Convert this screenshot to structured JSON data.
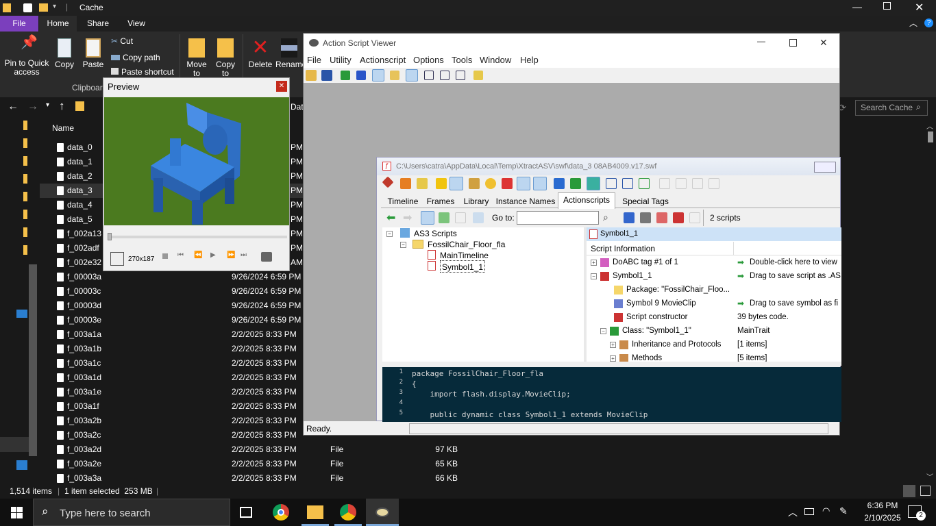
{
  "explorer": {
    "window_title": "Cache",
    "tabs": [
      "File",
      "Home",
      "Share",
      "View"
    ],
    "ribbon": {
      "pin_label": "Pin to Quick access",
      "copy_label": "Copy",
      "paste_label": "Paste",
      "cut_label": "Cut",
      "copy_path_label": "Copy path",
      "paste_shortcut_label": "Paste shortcut",
      "clipboard_group": "Clipboard",
      "move_to_label": "Move to",
      "copy_to_label": "Copy to",
      "delete_label": "Delete",
      "rename_label": "Rename"
    },
    "search_placeholder": "Search Cache",
    "column_name": "Name",
    "column_date_partial": "Dat",
    "files": [
      {
        "name": "data_0",
        "date": "",
        "type": "",
        "size": "",
        "partial": "PM"
      },
      {
        "name": "data_1",
        "date": "",
        "type": "",
        "size": "",
        "partial": "PM"
      },
      {
        "name": "data_2",
        "date": "",
        "type": "",
        "size": "",
        "partial": "PM"
      },
      {
        "name": "data_3",
        "date": "",
        "type": "",
        "size": "",
        "partial": "PM"
      },
      {
        "name": "data_4",
        "date": "",
        "type": "",
        "size": "",
        "partial": "PM"
      },
      {
        "name": "data_5",
        "date": "",
        "type": "",
        "size": "",
        "partial": "PM"
      },
      {
        "name": "f_002a13",
        "date": "",
        "type": "",
        "size": "",
        "partial": "PM"
      },
      {
        "name": "f_002adf",
        "date": "",
        "type": "",
        "size": "",
        "partial": "PM"
      },
      {
        "name": "f_002e32",
        "date": "",
        "type": "",
        "size": "",
        "partial": "AM"
      },
      {
        "name": "f_00003a",
        "date": "9/26/2024 6:59 PM",
        "type": "",
        "size": "",
        "partial": ""
      },
      {
        "name": "f_00003c",
        "date": "9/26/2024 6:59 PM",
        "type": "",
        "size": "",
        "partial": ""
      },
      {
        "name": "f_00003d",
        "date": "9/26/2024 6:59 PM",
        "type": "",
        "size": "",
        "partial": ""
      },
      {
        "name": "f_00003e",
        "date": "9/26/2024 6:59 PM",
        "type": "",
        "size": "",
        "partial": ""
      },
      {
        "name": "f_003a1a",
        "date": "2/2/2025 8:33 PM",
        "type": "",
        "size": "",
        "partial": ""
      },
      {
        "name": "f_003a1b",
        "date": "2/2/2025 8:33 PM",
        "type": "",
        "size": "",
        "partial": ""
      },
      {
        "name": "f_003a1c",
        "date": "2/2/2025 8:33 PM",
        "type": "",
        "size": "",
        "partial": ""
      },
      {
        "name": "f_003a1d",
        "date": "2/2/2025 8:33 PM",
        "type": "",
        "size": "",
        "partial": ""
      },
      {
        "name": "f_003a1e",
        "date": "2/2/2025 8:33 PM",
        "type": "",
        "size": "",
        "partial": ""
      },
      {
        "name": "f_003a1f",
        "date": "2/2/2025 8:33 PM",
        "type": "",
        "size": "",
        "partial": ""
      },
      {
        "name": "f_003a2b",
        "date": "2/2/2025 8:33 PM",
        "type": "",
        "size": "",
        "partial": ""
      },
      {
        "name": "f_003a2c",
        "date": "2/2/2025 8:33 PM",
        "type": "",
        "size": "",
        "partial": ""
      },
      {
        "name": "f_003a2d",
        "date": "2/2/2025 8:33 PM",
        "type": "File",
        "size": "97 KB",
        "partial": ""
      },
      {
        "name": "f_003a2e",
        "date": "2/2/2025 8:33 PM",
        "type": "File",
        "size": "65 KB",
        "partial": ""
      },
      {
        "name": "f_003a3a",
        "date": "2/2/2025 8:33 PM",
        "type": "File",
        "size": "66 KB",
        "partial": ""
      }
    ],
    "status_items": "1,514 items",
    "status_selected": "1 item selected  253 MB"
  },
  "preview": {
    "title": "Preview",
    "size_label": "270x187",
    "scene_colors": {
      "background": "#4b7a1f",
      "chair": "#3a7fd6"
    }
  },
  "asv": {
    "title": "Action Script Viewer",
    "menu": [
      "File",
      "Utility",
      "Actionscript",
      "Options",
      "Tools",
      "Window",
      "Help"
    ],
    "status": "Ready.",
    "doc": {
      "path": "C:\\Users\\catra\\AppData\\Local\\Temp\\XtractASV\\swf\\data_3 08AB4009.v17.swf",
      "tabs": [
        "Timeline",
        "Frames",
        "Library",
        "Instance Names",
        "Actionscripts",
        "Special Tags"
      ],
      "active_tab": "Actionscripts",
      "goto_label": "Go to:",
      "script_count": "2 scripts",
      "tree": {
        "root": "AS3 Scripts",
        "package": "FossilChair_Floor_fla",
        "items": [
          "MainTimeline",
          "Symbol1_1"
        ]
      },
      "info_header": "Symbol1_1",
      "info_title": "Script Information",
      "info_rows": [
        {
          "left": "DoABC tag #1 of 1",
          "right": "Double-click here to view"
        },
        {
          "left": "Symbol1_1",
          "right": "Drag to save script as .AS"
        },
        {
          "left": "Package: \"FossilChair_Floo...",
          "right": ""
        },
        {
          "left": "Symbol 9 MovieClip",
          "right": "Drag to save symbol as fi"
        },
        {
          "left": "Script constructor",
          "right": "39 bytes code."
        },
        {
          "left": "Class: \"Symbol1_1\"",
          "right": "MainTrait"
        },
        {
          "left": "Inheritance and Protocols",
          "right": "[1 items]"
        },
        {
          "left": "Methods",
          "right": "[5 items]"
        }
      ],
      "code_lines": [
        {
          "n": "1",
          "text": "package FossilChair_Floor_fla"
        },
        {
          "n": "2",
          "text": "{"
        },
        {
          "n": "3",
          "text": "    import flash.display.MovieClip;"
        },
        {
          "n": "4",
          "text": ""
        },
        {
          "n": "5",
          "text": "    public dynamic class Symbol1_1 extends MovieClip"
        }
      ]
    }
  },
  "taskbar": {
    "search_placeholder": "Type here to search",
    "time": "6:36 PM",
    "date": "2/10/2025",
    "notification_count": "2"
  }
}
